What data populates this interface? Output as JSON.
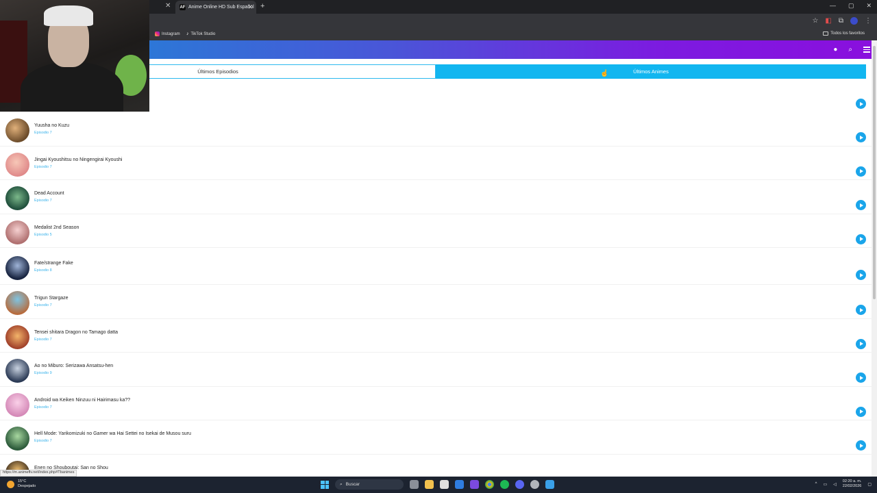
{
  "browser": {
    "active_tab_title": "Anime Online HD Sub Español",
    "tab_favicon_text": "AF",
    "bookmarks": [
      {
        "label": "Instagram",
        "icon": "instagram-icon"
      },
      {
        "label": "TikTok Studio",
        "icon": "tiktok-icon"
      }
    ],
    "all_bookmarks_label": "Todos los favoritos"
  },
  "site": {
    "header_gradient": [
      "#1b8bd6",
      "#8a0fde"
    ],
    "tabs": [
      {
        "label": "Últimos Episodios",
        "active": false
      },
      {
        "label": "Últimos Animes",
        "active": true
      }
    ],
    "accent": "#12b6f0"
  },
  "list": {
    "items": [
      {
        "title": "Yuusha no Kuzu",
        "episode": "Episodio 7"
      },
      {
        "title": "Jingai Kyoushitsu no Ningengirai Kyoushi",
        "episode": "Episodio 7"
      },
      {
        "title": "Dead Account",
        "episode": "Episodio 7"
      },
      {
        "title": "Medalist 2nd Season",
        "episode": "Episodio 5"
      },
      {
        "title": "Fate/strange Fake",
        "episode": "Episodio 8"
      },
      {
        "title": "Trigun Stargaze",
        "episode": "Episodio 7"
      },
      {
        "title": "Tensei shitara Dragon no Tamago datta",
        "episode": "Episodio 7"
      },
      {
        "title": "Ao no Miburo: Serizawa Ansatsu-hen",
        "episode": "Episodio 9"
      },
      {
        "title": "Android wa Keiken Ninzuu ni Hairimasu ka??",
        "episode": "Episodio 7"
      },
      {
        "title": "Hell Mode: Yarikomizuki no Gamer wa Hai Settei no Isekai de Musou suru",
        "episode": "Episodio 7"
      },
      {
        "title": "Enen no Shouboutai: San no Shou",
        "episode": ""
      }
    ]
  },
  "status_url": "https://m.animeflv.net/index.php#Tbanimes",
  "taskbar": {
    "weather_temp": "15°C",
    "weather_desc": "Despejado",
    "search_placeholder": "Buscar",
    "time": "02:20 a. m.",
    "date": "22/02/2026"
  }
}
